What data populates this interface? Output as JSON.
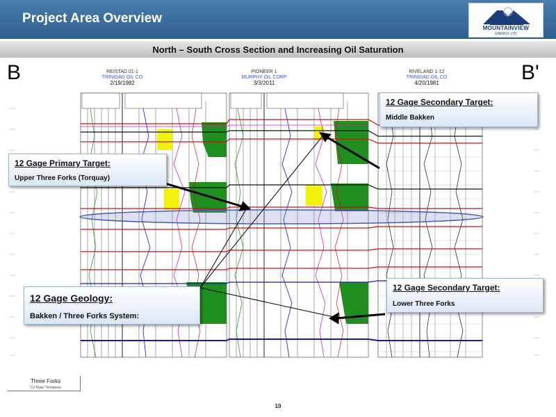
{
  "header": {
    "title": "Project Area Overview",
    "logo_text": "MOUNTAINVIEW",
    "logo_sub": "ENERGY LTD",
    "color": "#3a6c9c"
  },
  "subtitle": "North – South Cross Section and Increasing Oil Saturation",
  "section_labels": {
    "left": "B",
    "right": "B'"
  },
  "wells": [
    {
      "name": "REISTAD 01-1",
      "operator": "TRINIDAD OIL CO",
      "date": "2/19/1982"
    },
    {
      "name": "PIONEER 1",
      "operator": "MURPHY OIL CORP",
      "date": "3/3/2011"
    },
    {
      "name": "RIVELAND 1-12",
      "operator": "TRINIDAD OIL CO",
      "date": "4/20/1981"
    }
  ],
  "callouts": {
    "primary": {
      "title": "12 Gage Primary Target:",
      "body": "Upper Three Forks (Torquay)"
    },
    "secondary_middle": {
      "title": "12 Gage Secondary Target:",
      "body": "Middle Bakken"
    },
    "geology": {
      "title": "12 Gage Geology:",
      "body": "Bakken / Three Forks System:"
    },
    "secondary_lower": {
      "title": "12 Gage Secondary Target:",
      "body": "Lower Three Forks"
    }
  },
  "legend": {
    "title": "Three Forks",
    "subtitle": "Cy Ryan Thompson"
  },
  "page_number": "10",
  "colors": {
    "log_green": "#1f8f1f",
    "pay_yellow": "#f2f20a",
    "marker_red": "#cc1111",
    "marker_blue": "#1a1aaa",
    "highlight_ellipse": "#4a5aa8"
  }
}
